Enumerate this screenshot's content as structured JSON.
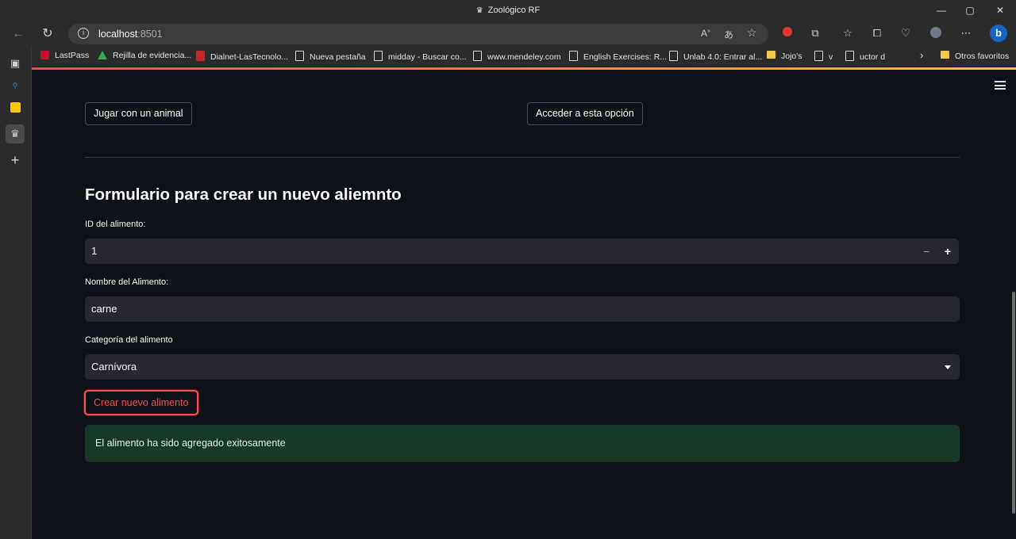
{
  "window": {
    "title": "Zoológico RF",
    "minimize": "—",
    "maximize": "▢",
    "close": "✕"
  },
  "browser": {
    "url_host": "localhost",
    "url_port": ":8501",
    "icons": [
      "read-aloud-icon",
      "translate-icon",
      "favorite-add-icon",
      "extension-icon",
      "favorites-icon",
      "collections-icon",
      "performance-icon",
      "profile-icon",
      "more-icon",
      "bing-icon"
    ],
    "bookmarks": [
      {
        "label": "LastPass",
        "icon": "lastpass-icon"
      },
      {
        "label": "Rejilla de evidencia...",
        "icon": "drive-icon"
      },
      {
        "label": "Dialnet-LasTecnolo...",
        "icon": "pdf-icon"
      },
      {
        "label": "Nueva pestaña",
        "icon": "page-icon"
      },
      {
        "label": "midday - Buscar co...",
        "icon": "page-icon"
      },
      {
        "label": "www.mendeley.com",
        "icon": "page-icon"
      },
      {
        "label": "English Exercises: R...",
        "icon": "page-icon"
      },
      {
        "label": "Unlab 4.0: Entrar al...",
        "icon": "page-icon"
      },
      {
        "label": "Jojo's",
        "icon": "folder-icon"
      },
      {
        "label": "v",
        "icon": "page-icon"
      },
      {
        "label": "uctor d",
        "icon": "page-icon"
      }
    ],
    "other_favorites": "Otros favoritos"
  },
  "app": {
    "buttons": {
      "play_animal": "Jugar con un animal",
      "access_option": "Acceder a esta opción"
    },
    "form": {
      "title": "Formulario para crear un nuevo aliemnto",
      "id_label": "ID del alimento:",
      "id_value": "1",
      "stepper_minus": "−",
      "stepper_plus": "+",
      "name_label": "Nombre del Alimento:",
      "name_value": "carne",
      "category_label": "Categoría del alimento",
      "category_value": "Carnívora",
      "submit_label": "Crear nuevo alimento",
      "success_message": "El alimento ha sido agregado exitosamente"
    }
  },
  "colors": {
    "accent": "#ff4b4b",
    "success_bg": "#173928",
    "field_bg": "#262730",
    "app_bg": "#0e1117"
  }
}
